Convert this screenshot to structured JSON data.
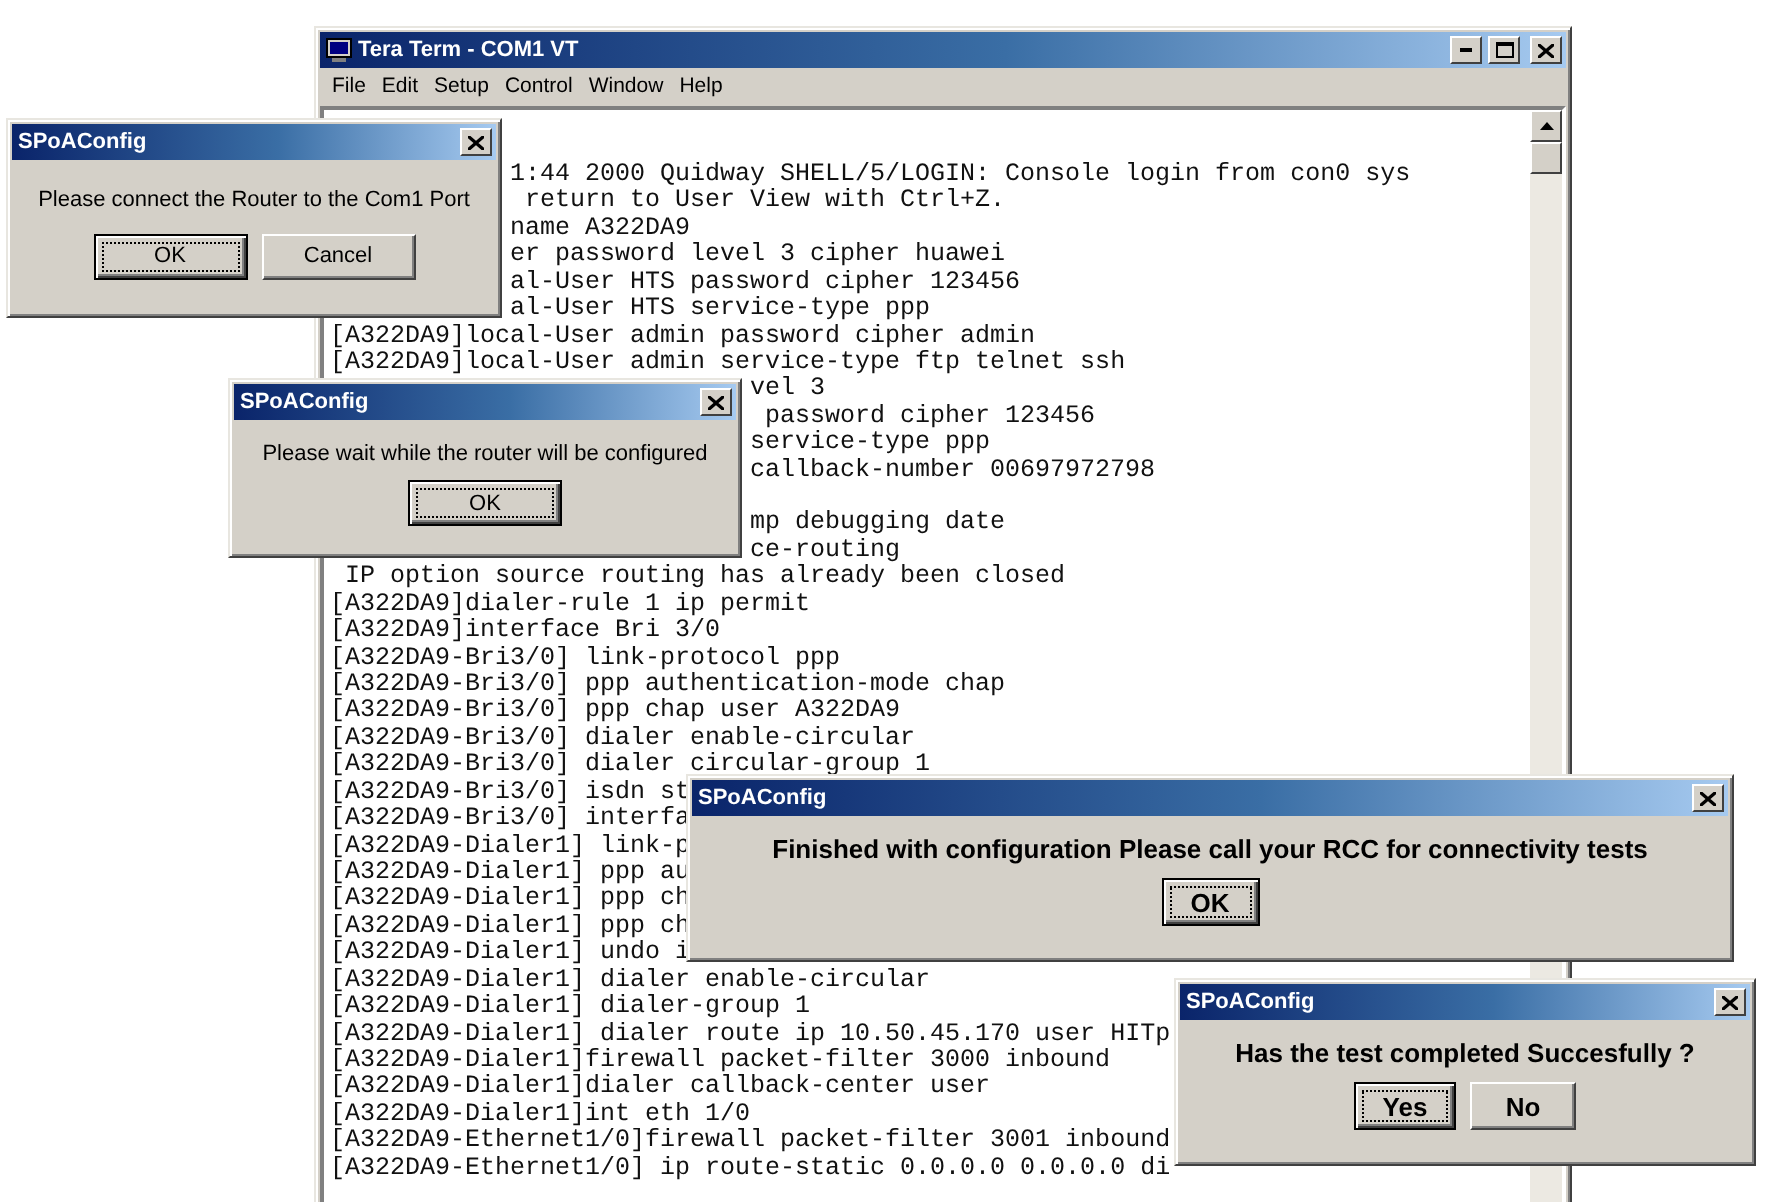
{
  "terminal_window": {
    "title": "Tera Term - COM1 VT",
    "menu": [
      {
        "label": "File"
      },
      {
        "label": "Edit"
      },
      {
        "label": "Setup"
      },
      {
        "label": "Control"
      },
      {
        "label": "Window"
      },
      {
        "label": "Help"
      }
    ],
    "lines": [
      {
        "text": "1:44 2000 Quidway SHELL/5/LOGIN: Console login from con0 sys"
      },
      {
        "text": "return to User View with Ctrl+Z."
      },
      {
        "text": "name A322DA9"
      },
      {
        "text": "er password level 3 cipher huawei"
      },
      {
        "text": "al-User HTS password cipher 123456"
      },
      {
        "text": "al-User HTS service-type ppp"
      },
      {
        "text": "[A322DA9]local-User admin password cipher admin"
      },
      {
        "text": "[A322DA9]local-User admin service-type ftp telnet ssh"
      },
      {
        "text": "vel 3"
      },
      {
        "text": "password cipher 123456"
      },
      {
        "text": "service-type ppp"
      },
      {
        "text": "callback-number 00697972798"
      },
      {
        "text": "mp debugging date"
      },
      {
        "text": "ce-routing"
      },
      {
        "text": "IP option source routing has already been closed"
      },
      {
        "text": "[A322DA9]dialer-rule 1 ip permit"
      },
      {
        "text": "[A322DA9]interface Bri 3/0"
      },
      {
        "text": "[A322DA9-Bri3/0] link-protocol ppp"
      },
      {
        "text": "[A322DA9-Bri3/0] ppp authentication-mode chap"
      },
      {
        "text": "[A322DA9-Bri3/0] ppp chap user A322DA9"
      },
      {
        "text": "[A322DA9-Bri3/0] dialer enable-circular"
      },
      {
        "text": "[A322DA9-Bri3/0] dialer circular-group 1"
      },
      {
        "text": "[A322DA9-Bri3/0] isdn st"
      },
      {
        "text": "[A322DA9-Bri3/0] interfa"
      },
      {
        "text": "[A322DA9-Dialer1] link-p"
      },
      {
        "text": "[A322DA9-Dialer1] ppp au"
      },
      {
        "text": "[A322DA9-Dialer1] ppp ch"
      },
      {
        "text": "[A322DA9-Dialer1] ppp ch"
      },
      {
        "text": "[A322DA9-Dialer1] undo i"
      },
      {
        "text": "[A322DA9-Dialer1] dialer enable-circular"
      },
      {
        "text": "[A322DA9-Dialer1] dialer-group 1"
      },
      {
        "text": "[A322DA9-Dialer1] dialer route ip 10.50.45.170 user HITp"
      },
      {
        "text": "[A322DA9-Dialer1]firewall packet-filter 3000 inbound"
      },
      {
        "text": "[A322DA9-Dialer1]dialer callback-center user"
      },
      {
        "text": "[A322DA9-Dialer1]int eth 1/0"
      },
      {
        "text": "[A322DA9-Ethernet1/0]firewall packet-filter 3001 inbound"
      },
      {
        "text": "[A322DA9-Ethernet1/0] ip route-static 0.0.0.0 0.0.0.0 di"
      }
    ]
  },
  "dialogs": [
    {
      "title": "SPoAConfig",
      "kind": "plain",
      "message": "Please connect the Router to the Com1 Port",
      "buttons": [
        {
          "label": "OK",
          "default": true
        },
        {
          "label": "Cancel",
          "default": false
        }
      ]
    },
    {
      "title": "SPoAConfig",
      "kind": "plain",
      "message": "Please wait while the router will be configured",
      "buttons": [
        {
          "label": "OK",
          "default": true
        }
      ]
    },
    {
      "title": "SPoAConfig",
      "kind": "large",
      "message": "Finished with configuration Please call your RCC for connectivity tests",
      "buttons": [
        {
          "label": "OK",
          "default": true
        }
      ]
    },
    {
      "title": "SPoAConfig",
      "kind": "large",
      "message": "Has the test completed Succesfully ?",
      "buttons": [
        {
          "label": "Yes",
          "default": true
        },
        {
          "label": "No",
          "default": false
        }
      ]
    }
  ]
}
